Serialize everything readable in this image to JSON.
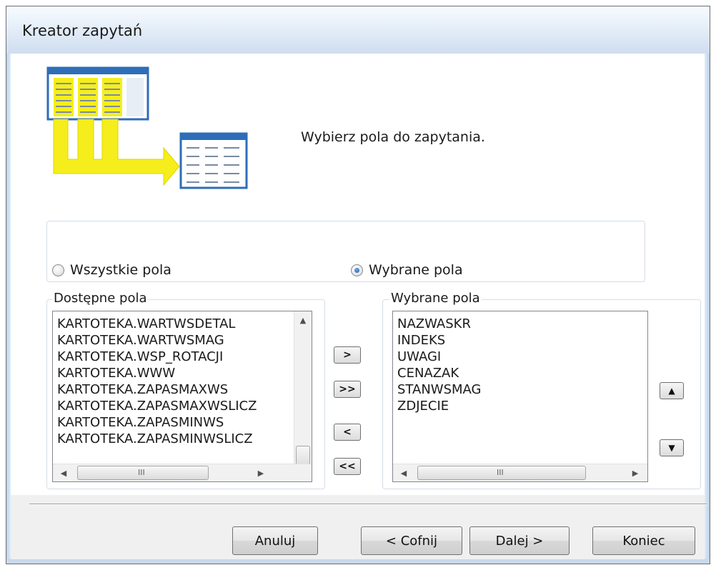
{
  "window": {
    "title": "Kreator zapytań"
  },
  "header": {
    "headline": "Wybierz pola do zapytania."
  },
  "field_mode": {
    "options": [
      {
        "label": "Wszystkie pola",
        "selected": false
      },
      {
        "label": "Wybrane pola",
        "selected": true
      }
    ]
  },
  "available": {
    "label": "Dostępne pola",
    "items": [
      "KARTOTEKA.WARTWSDETAL",
      "KARTOTEKA.WARTWSMAG",
      "KARTOTEKA.WSP_ROTACJI",
      "KARTOTEKA.WWW",
      "KARTOTEKA.ZAPASMAXWS",
      "KARTOTEKA.ZAPASMAXWSLICZ",
      "KARTOTEKA.ZAPASMINWS",
      "KARTOTEKA.ZAPASMINWSLICZ"
    ]
  },
  "selected": {
    "label": "Wybrane pola",
    "items": [
      "NAZWASKR",
      "INDEKS",
      "UWAGI",
      "CENAZAK",
      "STANWSMAG",
      "ZDJECIE"
    ]
  },
  "transfer_buttons": {
    "add": ">",
    "add_all": ">>",
    "remove": "<",
    "remove_all": "<<"
  },
  "order_buttons": {
    "up": "▲",
    "down": "▼"
  },
  "scroll_glyphs": {
    "up": "▲",
    "down": "▼",
    "left": "◀",
    "right": "▶",
    "grip": "III"
  },
  "footer": {
    "cancel": "Anuluj",
    "back": "< Cofnij",
    "next": "Dalej >",
    "finish": "Koniec"
  },
  "colors": {
    "accent_yellow": "#f5ee1c",
    "table_blue": "#2e6db8"
  }
}
